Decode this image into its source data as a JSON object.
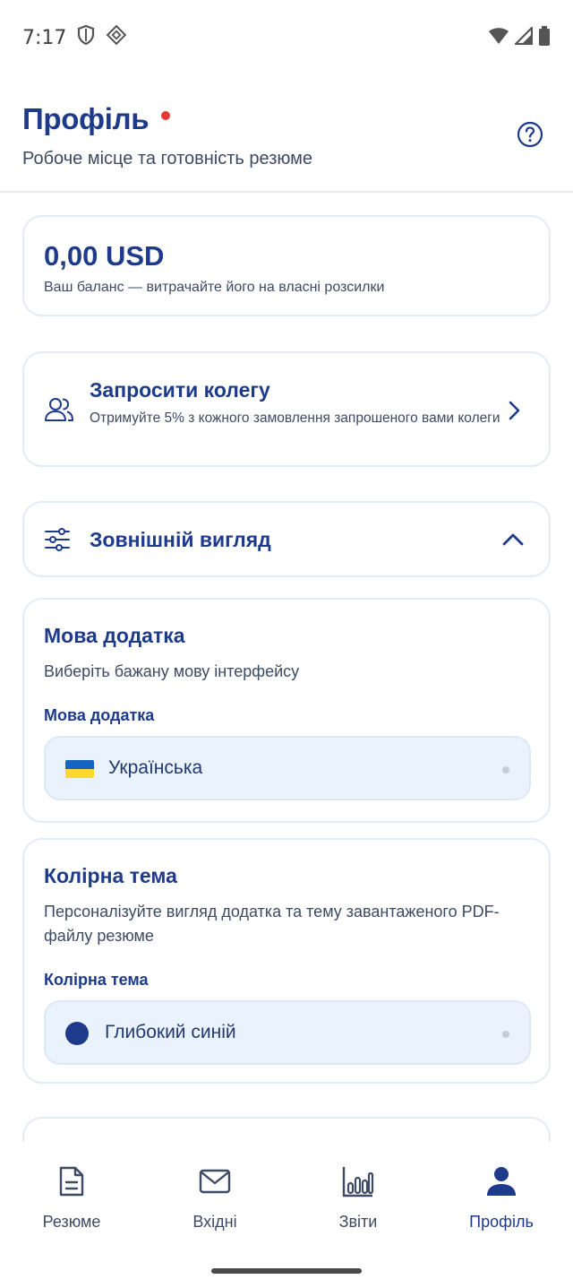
{
  "status_bar": {
    "time": "7:17",
    "icons_left": [
      "shield-icon",
      "nfc-icon"
    ],
    "icons_right": [
      "wifi-icon",
      "signal-icon",
      "battery-icon"
    ]
  },
  "header": {
    "title": "Профіль",
    "subtitle": "Робоче місце та готовність резюме",
    "help_icon": "help-circle-icon"
  },
  "balance": {
    "amount": "0,00 USD",
    "description": "Ваш баланс — витрачайте його на власні розсилки"
  },
  "invite": {
    "title": "Запросити колегу",
    "description": "Отримуйте 5% з кожного замовлення запрошеного вами колеги"
  },
  "appearance": {
    "title": "Зовнішній вигляд",
    "expanded": true
  },
  "language": {
    "title": "Мова додатка",
    "description": "Виберіть бажану мову інтерфейсу",
    "field_label": "Мова додатка",
    "selected": "Українська"
  },
  "color_theme": {
    "title": "Колірна тема",
    "description": "Персоналізуйте вигляд додатка та тему завантаженого PDF-файлу резюме",
    "field_label": "Колірна тема",
    "selected": "Глибокий синій",
    "selected_color": "#1e3a8a"
  },
  "bottom_nav": {
    "items": [
      {
        "label": "Резюме",
        "icon": "document-icon",
        "active": false
      },
      {
        "label": "Вхідні",
        "icon": "mail-icon",
        "active": false
      },
      {
        "label": "Звіти",
        "icon": "chart-icon",
        "active": false
      },
      {
        "label": "Профіль",
        "icon": "person-icon",
        "active": true
      }
    ]
  },
  "colors": {
    "primary": "#1e3a8a",
    "accent_red": "#e53935",
    "select_bg": "#eaf3fd",
    "border": "#e3ebf7"
  }
}
